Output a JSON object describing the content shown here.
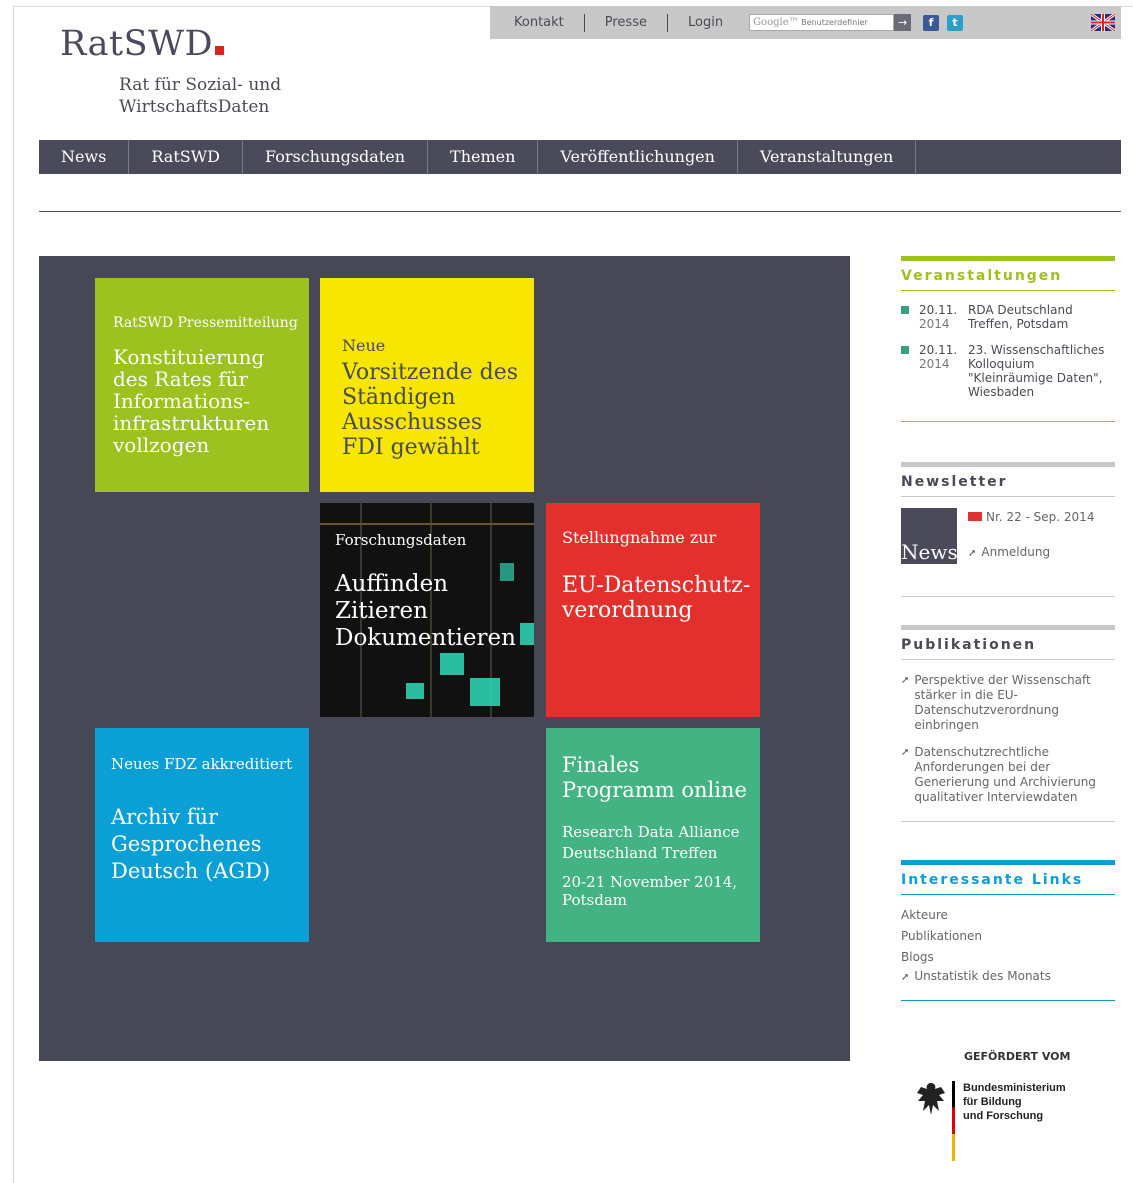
{
  "header": {
    "logo_title": "RatSWD",
    "logo_sub1": "Rat für Sozial- und",
    "logo_sub2": "WirtschaftsDaten",
    "topbar": {
      "links": [
        "Kontakt",
        "Presse",
        "Login"
      ],
      "search_brand": "Google™",
      "search_placeholder": "Benutzerdefinier",
      "search_go": "→",
      "facebook": "f",
      "twitter": "t"
    }
  },
  "nav": [
    "News",
    "RatSWD",
    "Forschungsdaten",
    "Themen",
    "Veröffentlichungen",
    "Veranstaltungen"
  ],
  "tiles": {
    "green": {
      "kicker": "RatSWD Pressemitteilung",
      "title": "Konstituierung des Rates für Informations-infrastrukturen vollzogen"
    },
    "yellow": {
      "kicker": "Neue",
      "title": "Vorsitzende des Ständigen Ausschusses FDI gewählt"
    },
    "dark": {
      "kicker": "Forschungsdaten",
      "line1": "Auffinden",
      "line2": "Zitieren",
      "line3": "Dokumentieren"
    },
    "red": {
      "kicker": "Stellungnahme zur",
      "title": "EU-Datenschutz-verordnung"
    },
    "blue": {
      "kicker": "Neues FDZ akkreditiert",
      "title": "Archiv für Gesprochenes Deutsch (AGD)"
    },
    "teal": {
      "title": "Finales Programm online",
      "sub": "Research Data Alliance Deutschland Treffen",
      "date": "20-21 November 2014, Potsdam"
    }
  },
  "sidebar": {
    "events": {
      "title": "Veranstaltungen",
      "items": [
        {
          "date": "20.11.",
          "year": "2014",
          "text": "RDA Deutschland Treffen, Potsdam"
        },
        {
          "date": "20.11.",
          "year": "2014",
          "text": "23. Wissenschaftliches Kolloquium \"Kleinräumige Daten\", Wiesbaden"
        }
      ]
    },
    "newsletter": {
      "title": "Newsletter",
      "thumb": "News",
      "issue": "Nr. 22 - Sep. 2014",
      "signup": "Anmeldung"
    },
    "publications": {
      "title": "Publikationen",
      "items": [
        "Perspektive der Wissenschaft stärker in die EU-Datenschutzverordnung einbringen",
        "Datenschutzrechtliche Anforderungen bei der Generierung und Archivierung qualitativer Interviewdaten"
      ]
    },
    "links": {
      "title": "Interessante Links",
      "items": [
        "Akteure",
        "Publikationen",
        "Blogs",
        "Unstatistik des Monats"
      ]
    },
    "funder": {
      "heading": "GEFÖRDERT VOM",
      "line1": "Bundesministerium",
      "line2": "für Bildung",
      "line3": "und Forschung"
    }
  },
  "colors": {
    "nav": "#4a4a5a",
    "green": "#9dc11f",
    "yellow": "#f6e600",
    "red": "#e3302d",
    "blue": "#0aa0d6",
    "teal": "#44b383"
  }
}
